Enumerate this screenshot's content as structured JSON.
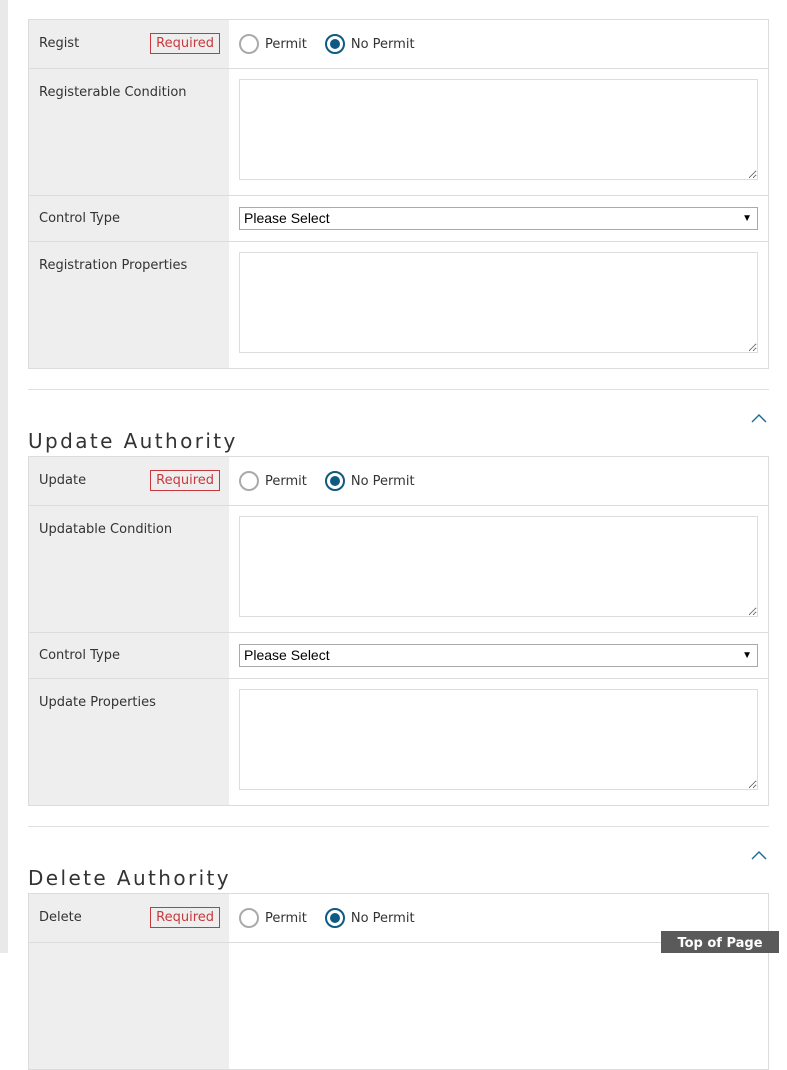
{
  "colors": {
    "accent": "#0f5a82",
    "required": "#c8393d",
    "label_bg": "#eeeeee"
  },
  "sections": [
    {
      "title": null,
      "rows": [
        {
          "type": "radio",
          "label": "Regist",
          "required": "Required",
          "options": [
            "Permit",
            "No Permit"
          ],
          "selected": "No Permit"
        },
        {
          "type": "textarea",
          "label": "Registerable Condition",
          "value": ""
        },
        {
          "type": "select",
          "label": "Control Type",
          "value": "Please Select"
        },
        {
          "type": "textarea",
          "label": "Registration Properties",
          "value": ""
        }
      ]
    },
    {
      "title": "Update Authority",
      "icon": "chevron-up-icon",
      "rows": [
        {
          "type": "radio",
          "label": "Update",
          "required": "Required",
          "options": [
            "Permit",
            "No Permit"
          ],
          "selected": "No Permit"
        },
        {
          "type": "textarea",
          "label": "Updatable Condition",
          "value": ""
        },
        {
          "type": "select",
          "label": "Control Type",
          "value": "Please Select"
        },
        {
          "type": "textarea",
          "label": "Update Properties",
          "value": ""
        }
      ]
    },
    {
      "title": "Delete Authority",
      "icon": "chevron-up-icon",
      "rows": [
        {
          "type": "radio",
          "label": "Delete",
          "required": "Required",
          "options": [
            "Permit",
            "No Permit"
          ],
          "selected": "No Permit"
        }
      ]
    }
  ],
  "top_of_page": "Top of Page",
  "select_arrow": "▼"
}
